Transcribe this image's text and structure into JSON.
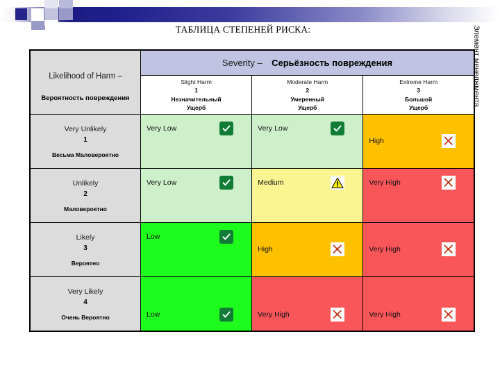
{
  "slide": {
    "title": "ТАБЛИЦА СТЕПЕНЕЙ РИСКА:",
    "side_label": "Элемент менеджмента"
  },
  "table": {
    "likelihood_header": {
      "en": "Likelihood of Harm  –",
      "ru": "Вероятность повреждения"
    },
    "severity_header": {
      "en": "Severity –",
      "ru": "Серьёзность повреждения"
    },
    "severity_columns": [
      {
        "en": "Slight Harm",
        "num": "1",
        "ru1": "Незначительный",
        "ru2": "Ущерб"
      },
      {
        "en": "Moderate Harm",
        "num": "2",
        "ru1": "Умеренный",
        "ru2": "Ущерб"
      },
      {
        "en": "Extreme Harm",
        "num": "3",
        "ru1": "Большой",
        "ru2": "Ущерб"
      }
    ],
    "rows": [
      {
        "likelihood": {
          "en": "Very Unlikely",
          "num": "1",
          "ru": "Весьма Маловероятно"
        },
        "cells": [
          {
            "label": "Very Low",
            "icon": "check-icon",
            "bg": "#cdf0ca",
            "pos": "pos-top"
          },
          {
            "label": "Very Low",
            "icon": "check-icon",
            "bg": "#cdf0ca",
            "pos": "pos-top"
          },
          {
            "label": "High",
            "icon": "cross-icon",
            "bg": "#fdc100",
            "pos": "pos-mid"
          }
        ]
      },
      {
        "likelihood": {
          "en": "Unlikely",
          "num": "2",
          "ru": "Маловероятно"
        },
        "cells": [
          {
            "label": "Very Low",
            "icon": "check-icon",
            "bg": "#cdf0ca",
            "pos": "pos-top"
          },
          {
            "label": "Medium",
            "icon": "warning-icon",
            "bg": "#fbf591",
            "pos": "pos-top"
          },
          {
            "label": "Very High",
            "icon": "cross-icon",
            "bg": "#f9565a",
            "pos": "pos-top"
          }
        ]
      },
      {
        "likelihood": {
          "en": "Likely",
          "num": "3",
          "ru": "Вероятно"
        },
        "cells": [
          {
            "label": "Low",
            "icon": "check-icon",
            "bg": "#1efc1e",
            "pos": "pos-top"
          },
          {
            "label": "High",
            "icon": "cross-icon",
            "bg": "#fdc100",
            "pos": "pos-mid"
          },
          {
            "label": "Very High",
            "icon": "cross-icon",
            "bg": "#f9565a",
            "pos": "pos-mid"
          }
        ]
      },
      {
        "likelihood": {
          "en": "Very Likely",
          "num": "4",
          "ru": "Очень Вероятно"
        },
        "cells": [
          {
            "label": "Low",
            "icon": "check-icon",
            "bg": "#1efc1e",
            "pos": "pos-lower"
          },
          {
            "label": "Very High",
            "icon": "cross-icon",
            "bg": "#f9565a",
            "pos": "pos-lower"
          },
          {
            "label": "Very High",
            "icon": "cross-icon",
            "bg": "#f9565a",
            "pos": "pos-lower"
          }
        ]
      }
    ]
  },
  "colors": {
    "very_low": "#cdf0ca",
    "low": "#1efc1e",
    "medium": "#fbf591",
    "high": "#fdc100",
    "very_high": "#f9565a",
    "header_likelihood": "#dcdcdc",
    "header_severity": "#c0c4e2",
    "check_green": "#107c36",
    "cross_red": "#c3300f",
    "warn_yellow": "#fbf000",
    "banner_navy": "#1c1c84"
  }
}
